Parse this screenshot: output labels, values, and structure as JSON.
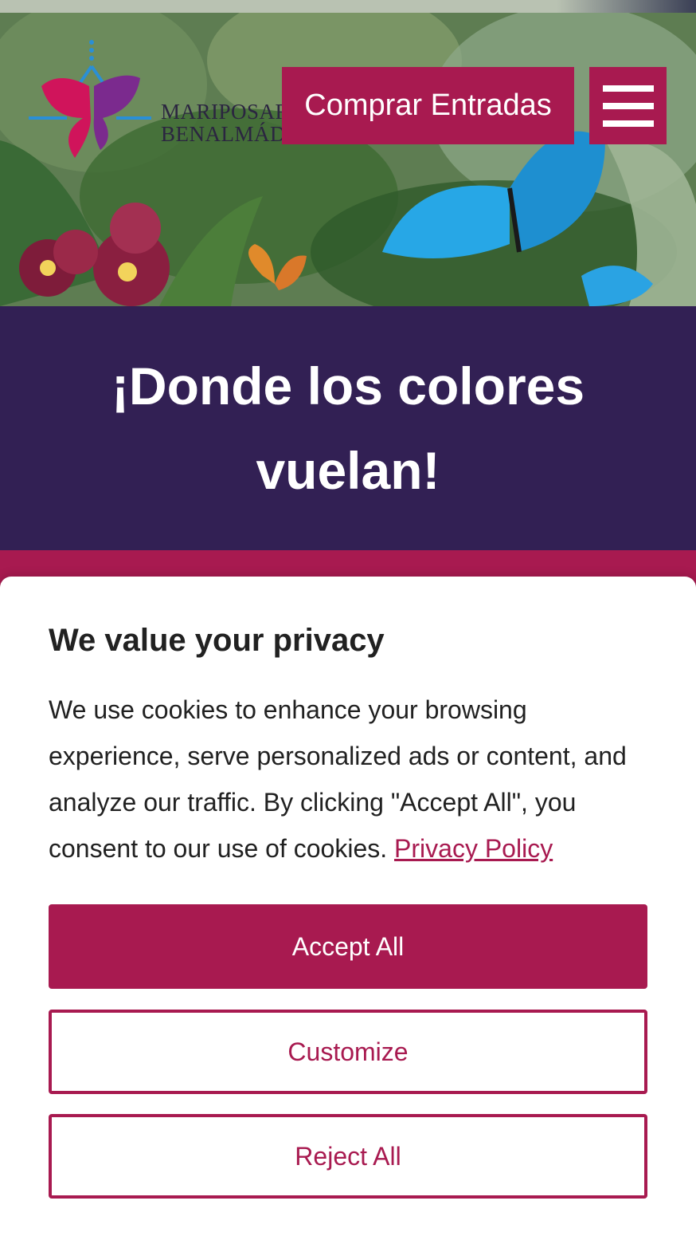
{
  "header": {
    "logo_text_line1": "MARIPOSARIO",
    "logo_text_line2": "BENALMÁDENA",
    "buy_button_label": "Comprar Entradas",
    "menu_icon": "hamburger-menu-icon"
  },
  "hero": {
    "tagline": "¡Donde los colores vuelan!"
  },
  "cookie_banner": {
    "title": "We value your privacy",
    "body": "We use cookies to enhance your browsing experience, serve personalized ads or content, and analyze our traffic. By clicking \"Accept All\", you consent to our use of cookies.",
    "privacy_link": "Privacy Policy",
    "accept_label": "Accept All",
    "customize_label": "Customize",
    "reject_label": "Reject All"
  },
  "colors": {
    "brand": "#a81a50",
    "tagline_bg": "#322054"
  }
}
